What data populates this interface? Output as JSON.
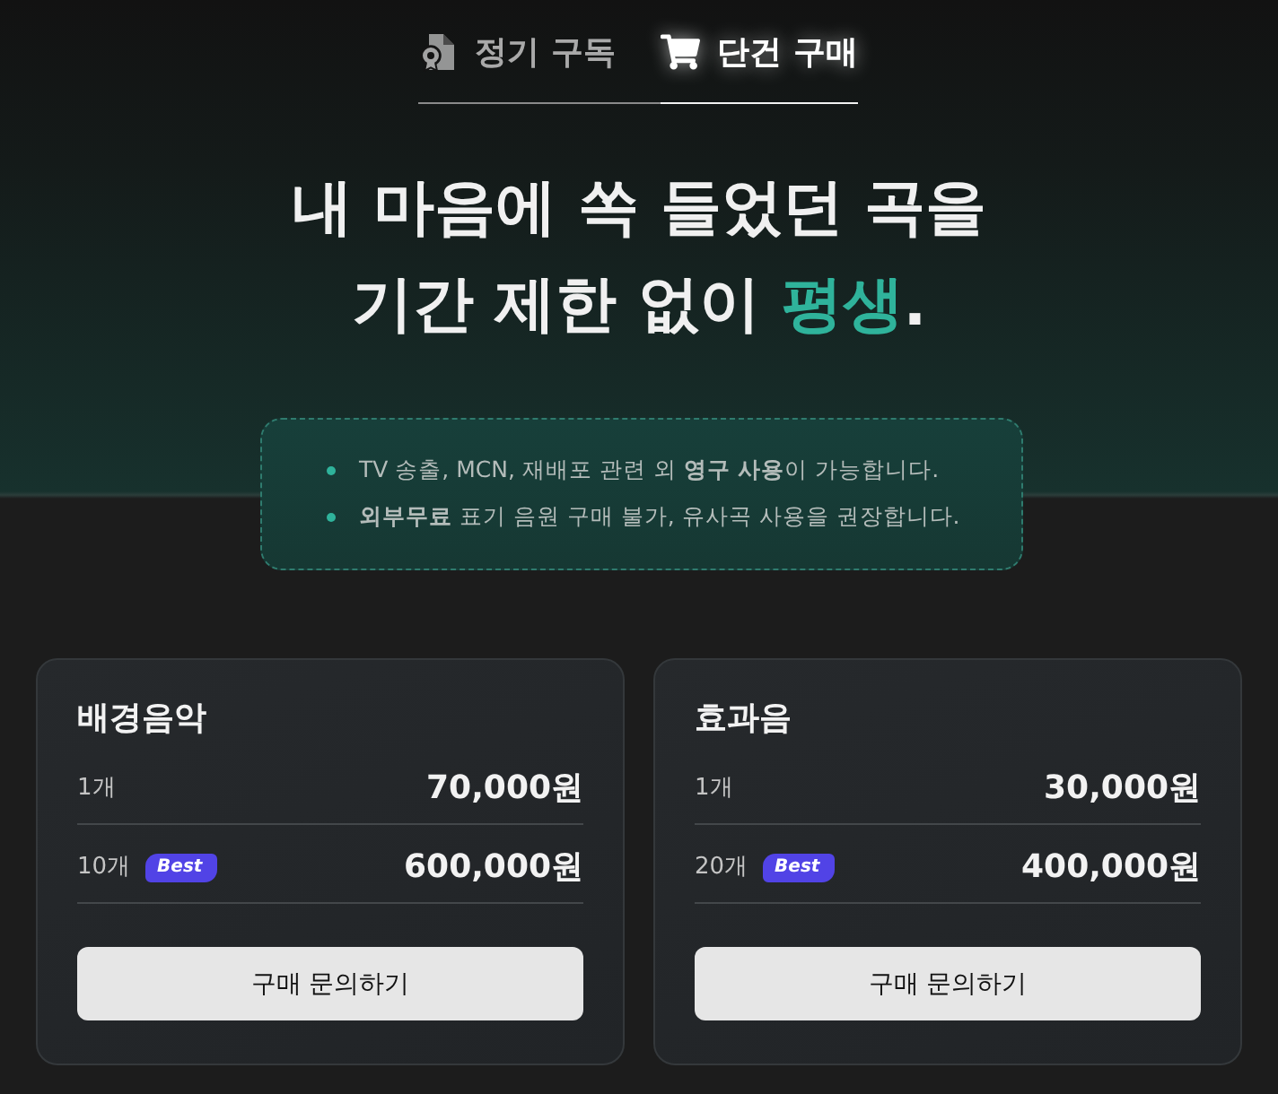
{
  "tabs": [
    {
      "label": "정기 구독",
      "selected": false
    },
    {
      "label": "단건 구매",
      "selected": true
    }
  ],
  "headline": [
    {
      "segments": [
        {
          "text": "내 마음에 쏙 들었던 곡을",
          "highlight": false
        }
      ]
    },
    {
      "segments": [
        {
          "text": "기간 제한 없이 ",
          "highlight": false
        },
        {
          "text": "평생",
          "highlight": true
        },
        {
          "text": ".",
          "highlight": false
        }
      ]
    }
  ],
  "notice": {
    "items": [
      "TV 송출, MCN, 재배포 관련 외 **영구 사용**이 가능합니다.",
      "**외부무료** 표기 음원 구매 불가, 유사곡 사용을 권장합니다."
    ]
  },
  "plans": [
    {
      "title": "배경음악",
      "rows": [
        {
          "quantity": "1개",
          "price": "70,000원"
        },
        {
          "quantity": "10개",
          "badge": "Best",
          "price": "600,000원"
        }
      ],
      "button": "구매 문의하기"
    },
    {
      "title": "효과음",
      "rows": [
        {
          "quantity": "1개",
          "price": "30,000원"
        },
        {
          "quantity": "20개",
          "badge": "Best",
          "price": "400,000원"
        }
      ],
      "button": "구매 문의하기"
    }
  ]
}
